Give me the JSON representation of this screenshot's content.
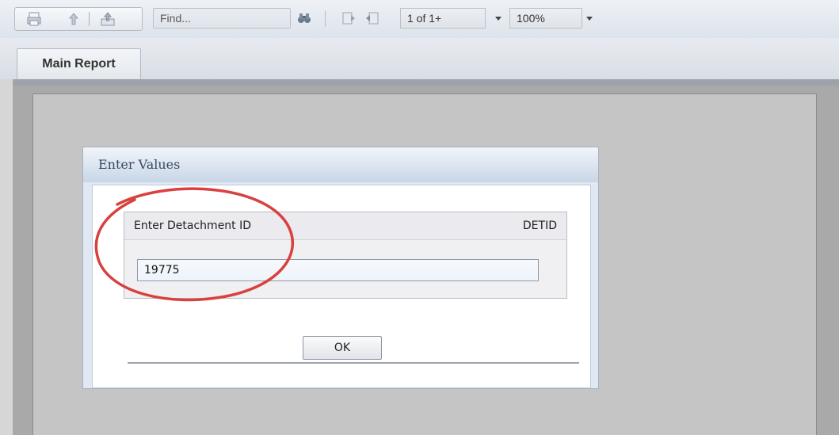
{
  "toolbar": {
    "print_icon": "printer-icon",
    "up_icon": "arrow-up-icon",
    "export_icon": "export-icon",
    "find_placeholder": "Find...",
    "binoculars_icon": "binoculars-icon",
    "prev_page_icon": "page-previous-icon",
    "next_page_icon": "page-next-icon",
    "page_indicator": "1 of 1+",
    "zoom": "100%"
  },
  "tabs": [
    {
      "label": "Main Report"
    }
  ],
  "dialog": {
    "title": "Enter Values",
    "parameter": {
      "label": "Enter Detachment ID",
      "code": "DETID",
      "value": "19775"
    },
    "ok_label": "OK"
  },
  "colors": {
    "dialog_header": "#c8d6e7",
    "annotation_circle": "#d9413f"
  }
}
